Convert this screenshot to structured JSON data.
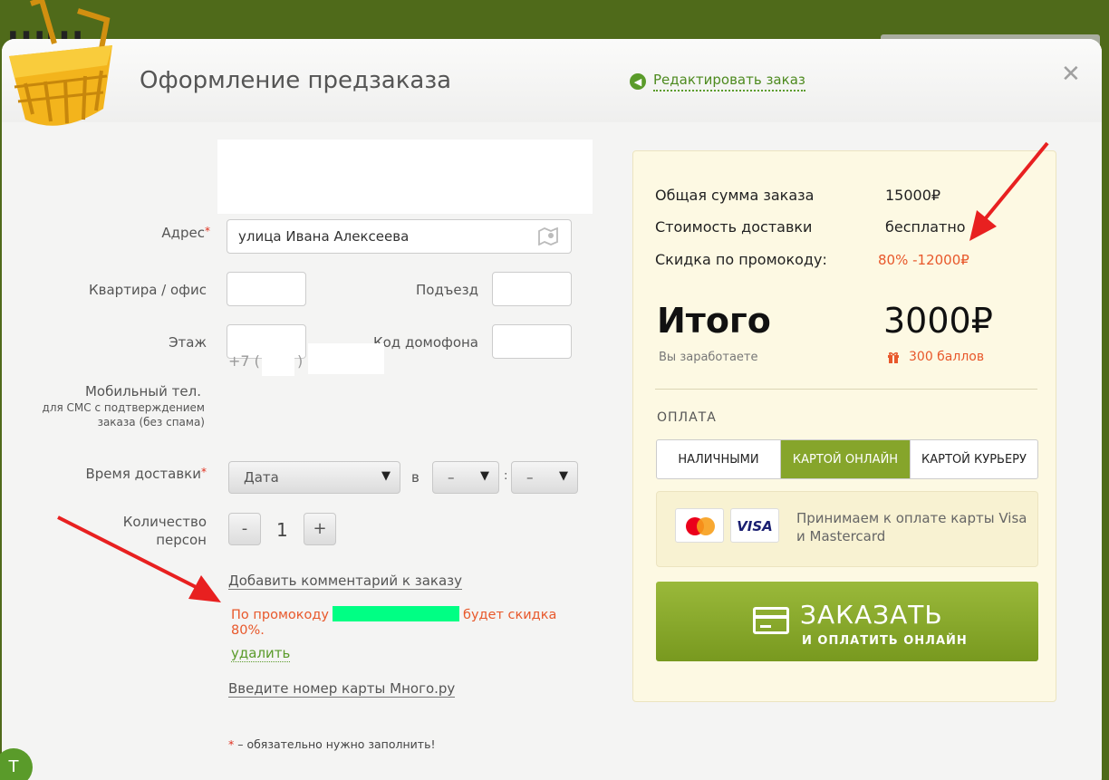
{
  "modal": {
    "title": "Оформление предзаказа",
    "edit_link": "Редактировать заказ",
    "close_symbol": "✕"
  },
  "form": {
    "address_label": "Адрес",
    "address_value": "улица Ивана Алексеева",
    "required_mark": "*",
    "apartment_label": "Квартира / офис",
    "entrance_label": "Подъезд",
    "floor_label": "Этаж",
    "intercom_label": "Код домофона",
    "phone_label": "Мобильный тел.",
    "phone_hint": "для СМС с подтверждением заказа (без спама)",
    "phone_prefix": "+7 (",
    "phone_close": ")",
    "delivery_label": "Время доставки",
    "date_select": "Дата",
    "at_label": "в",
    "hour_select": "–",
    "time_colon": ":",
    "minute_select": "–",
    "persons_label_1": "Количество",
    "persons_label_2": "персон",
    "minus": "-",
    "persons_count": "1",
    "plus": "+",
    "add_comment": "Добавить комментарий к заказу",
    "promo_pre": "По промокоду",
    "promo_post": "будет скидка",
    "promo_percent": "80%.",
    "delete_link": "удалить",
    "card_number_link": "Введите номер карты Много.ру",
    "footnote_star": "*",
    "footnote_text": " – обязательно нужно заполнить!"
  },
  "summary": {
    "order_total_label": "Общая сумма заказа",
    "order_total_value": "15000₽",
    "delivery_label": "Стоимость доставки",
    "delivery_value": "бесплатно",
    "promo_label": "Скидка по промокоду:",
    "promo_value": "80% -12000₽",
    "total_label": "Итого",
    "total_value": "3000₽",
    "earn_label": "Вы заработаете",
    "earn_value": "300 баллов"
  },
  "payment": {
    "heading": "ОПЛАТА",
    "tabs": [
      {
        "label": "НАЛИЧНЫМИ",
        "active": false
      },
      {
        "label": "КАРТОЙ ОНЛАЙН",
        "active": true
      },
      {
        "label": "КАРТОЙ КУРЬЕРУ",
        "active": false
      }
    ],
    "visa_logo": "VISA",
    "cards_text": "Принимаем к оплате карты Visa и Mastercard",
    "order_button": "ЗАКАЗАТЬ",
    "order_button_sub": "И ОПЛАТИТЬ ОНЛАЙН"
  },
  "colors": {
    "accent_green": "#86a52b",
    "promo_orange": "#e8582b",
    "annotation_red": "#e82020"
  },
  "background": {
    "site_text_fragment": "ШШ",
    "chat_icon": "Т"
  }
}
